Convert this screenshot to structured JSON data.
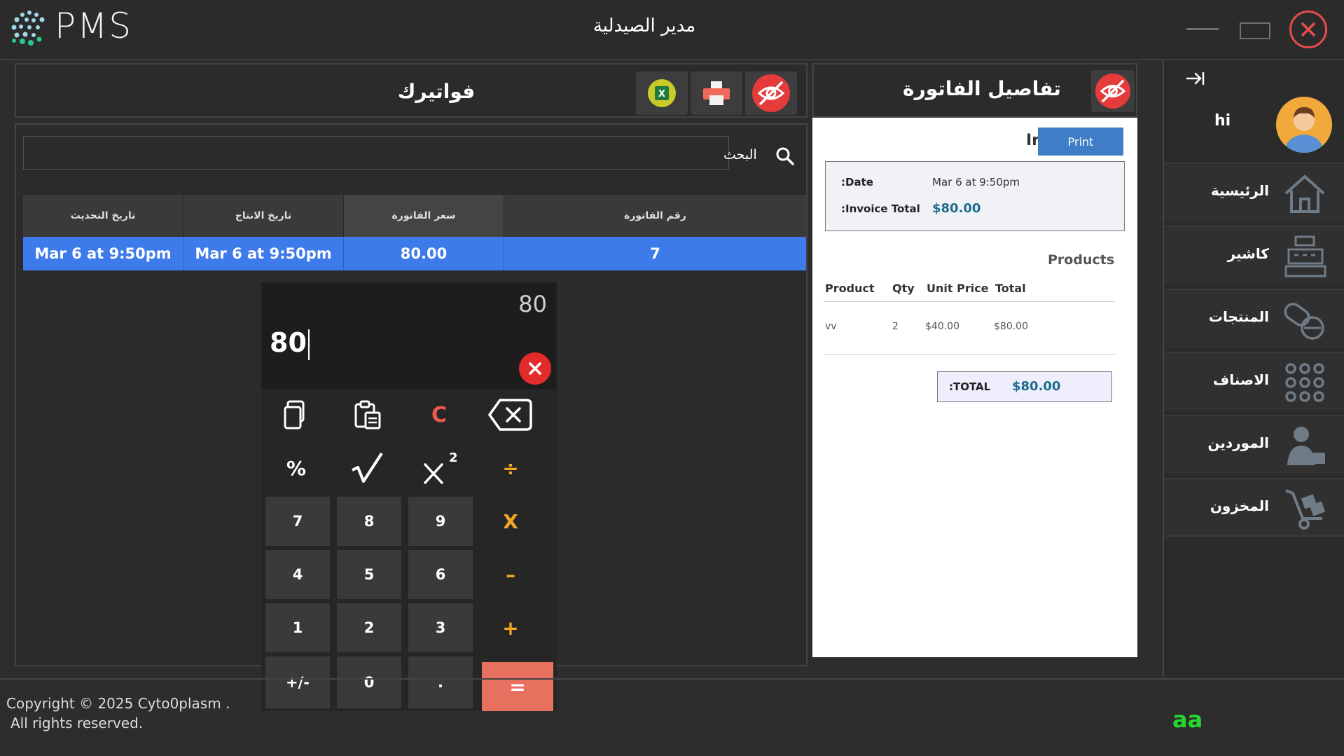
{
  "app": {
    "logo_text": "PMS",
    "title": "مدير الصيدلية"
  },
  "invoices": {
    "title": "فواتيرك",
    "search_label": "البحث",
    "search_value": "",
    "columns": [
      "رقم الفاتورة",
      "سعر الفاتورة",
      "تاريخ الانتاج",
      "تاريخ التحديث"
    ],
    "rows": [
      {
        "number": "7",
        "price": "80.00",
        "created": "Mar 6 at 9:50pm",
        "updated": "Mar 6 at 9:50pm"
      }
    ]
  },
  "calculator": {
    "previous": "80",
    "current": "80",
    "keys": {
      "clear": "C",
      "percent": "%",
      "divide": "÷",
      "multiply": "X",
      "minus": "–",
      "plus": "+",
      "equals": "=",
      "negate": "+/-",
      "dot": ".",
      "d7": "7",
      "d8": "8",
      "d9": "9",
      "d4": "4",
      "d5": "5",
      "d6": "6",
      "d1": "1",
      "d2": "2",
      "d3": "3",
      "d0": "0"
    }
  },
  "details": {
    "title": "تفاصيل الفاتورة",
    "partial_title": "Ir",
    "print_label": "Print",
    "date_label": ":Date",
    "date_value": "Mar 6 at 9:50pm",
    "total_label": ":Invoice Total",
    "total_value": "$80.00",
    "products_title": "Products",
    "product_columns": [
      "Product",
      "Qty",
      "Unit Price",
      "Total"
    ],
    "products": [
      {
        "product": "vv",
        "qty": "2",
        "unit_price": "$40.00",
        "total": "$80.00"
      }
    ],
    "grand_total_label": ":TOTAL",
    "grand_total_value": "$80.00"
  },
  "sidebar": {
    "user_name": "hi",
    "items": [
      {
        "label": "الرئيسية",
        "icon": "home-icon"
      },
      {
        "label": "كاشير",
        "icon": "cash-register-icon"
      },
      {
        "label": "المنتجات",
        "icon": "pills-icon"
      },
      {
        "label": "الاصناف",
        "icon": "grid-icon"
      },
      {
        "label": "الموردين",
        "icon": "supplier-icon"
      },
      {
        "label": "المخزون",
        "icon": "warehouse-cart-icon"
      }
    ]
  },
  "footer": {
    "copyright_line1": "Copyright © 2025 Cyto0plasm .",
    "copyright_line2": "All rights reserved.",
    "tag": "aa"
  },
  "colors": {
    "accent_blue": "#3e7bea",
    "danger_red": "#e74c4c",
    "operator_orange": "#f5a623",
    "equals_salmon": "#e8705e",
    "tag_green": "#23d930"
  }
}
